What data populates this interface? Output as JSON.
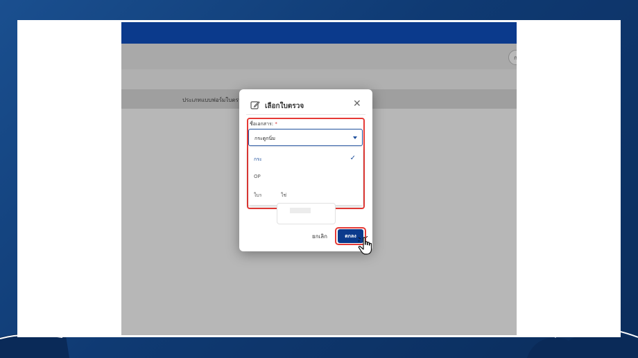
{
  "app": {
    "table_header_label": "ประเภทแบบฟอร์มใบตรวจ",
    "side_button_label": "ก"
  },
  "modal": {
    "title": "เลือกใบตรวจ",
    "icon": "edit-icon",
    "close_icon": "close-icon",
    "field_label": "ชื่อเอกสาร:",
    "required_mark": "*",
    "selected_value": "กระดูกนิ่ม",
    "options": [
      {
        "label": "กระ",
        "selected": true
      },
      {
        "label": "OP",
        "selected": false
      },
      {
        "label": "ใบร",
        "selected": false
      }
    ],
    "option_suffix_visible": "ใช่",
    "cancel_label": "ยกเลิก",
    "ok_label": "ตกลง"
  },
  "colors": {
    "brand": "#0b3a8c",
    "highlight": "#e53935",
    "background": "#0f3a73"
  }
}
